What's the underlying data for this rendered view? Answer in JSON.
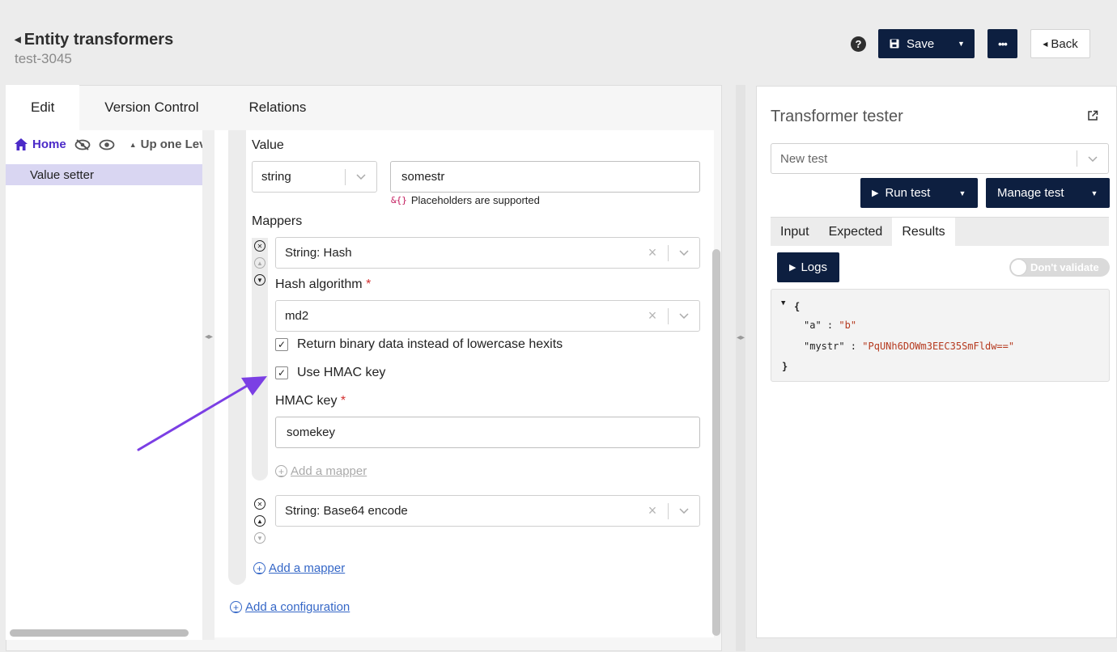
{
  "header": {
    "title": "Entity transformers",
    "subtitle": "test-3045",
    "help_label": "?",
    "save_label": "Save",
    "more_label": "•••",
    "back_label": "Back"
  },
  "tabs": [
    {
      "label": "Edit",
      "active": true
    },
    {
      "label": "Version Control",
      "active": false
    },
    {
      "label": "Relations",
      "active": false
    }
  ],
  "tree": {
    "home_label": "Home",
    "up_label": "Up one Lev",
    "selected_item": "Value setter"
  },
  "editor": {
    "value_label": "Value",
    "type_value": "string",
    "value_input": "somestr",
    "placeholder_hint_icon": "&{}",
    "placeholder_hint": "Placeholders are supported",
    "mappers_label": "Mappers",
    "mapper1": {
      "name": "String: Hash",
      "algorithm_label": "Hash algorithm",
      "algorithm_value": "md2",
      "binary_label": "Return binary data instead of lowercase hexits",
      "binary_checked": true,
      "hmac_label": "Use HMAC key",
      "hmac_checked": true,
      "hmac_key_label": "HMAC key",
      "hmac_key_value": "somekey",
      "add_mapper_label": "Add a mapper"
    },
    "mapper2": {
      "name": "String: Base64 encode"
    },
    "add_mapper_label": "Add a mapper",
    "add_configuration_label": "Add a configuration",
    "required_mark": "*"
  },
  "tester": {
    "title": "Transformer tester",
    "test_select": "New test",
    "run_label": "Run test",
    "manage_label": "Manage test",
    "tabs": [
      {
        "label": "Input",
        "active": false
      },
      {
        "label": "Expected",
        "active": false
      },
      {
        "label": "Results",
        "active": true
      }
    ],
    "logs_label": "Logs",
    "validate_toggle_label": "Don't validate",
    "result_json": {
      "open": "{",
      "close": "}",
      "lines": [
        {
          "key": "\"a\"",
          "value": "\"b\""
        },
        {
          "key": "\"mystr\"",
          "value": "\"PqUNh6DOWm3EEC35SmFldw==\""
        }
      ]
    }
  },
  "colors": {
    "primary_navy": "#0d1f40",
    "accent_purple": "#4b2ac8",
    "link_blue": "#3567c7",
    "arrow_violet": "#7b3fe4",
    "json_string": "#b5391e"
  }
}
